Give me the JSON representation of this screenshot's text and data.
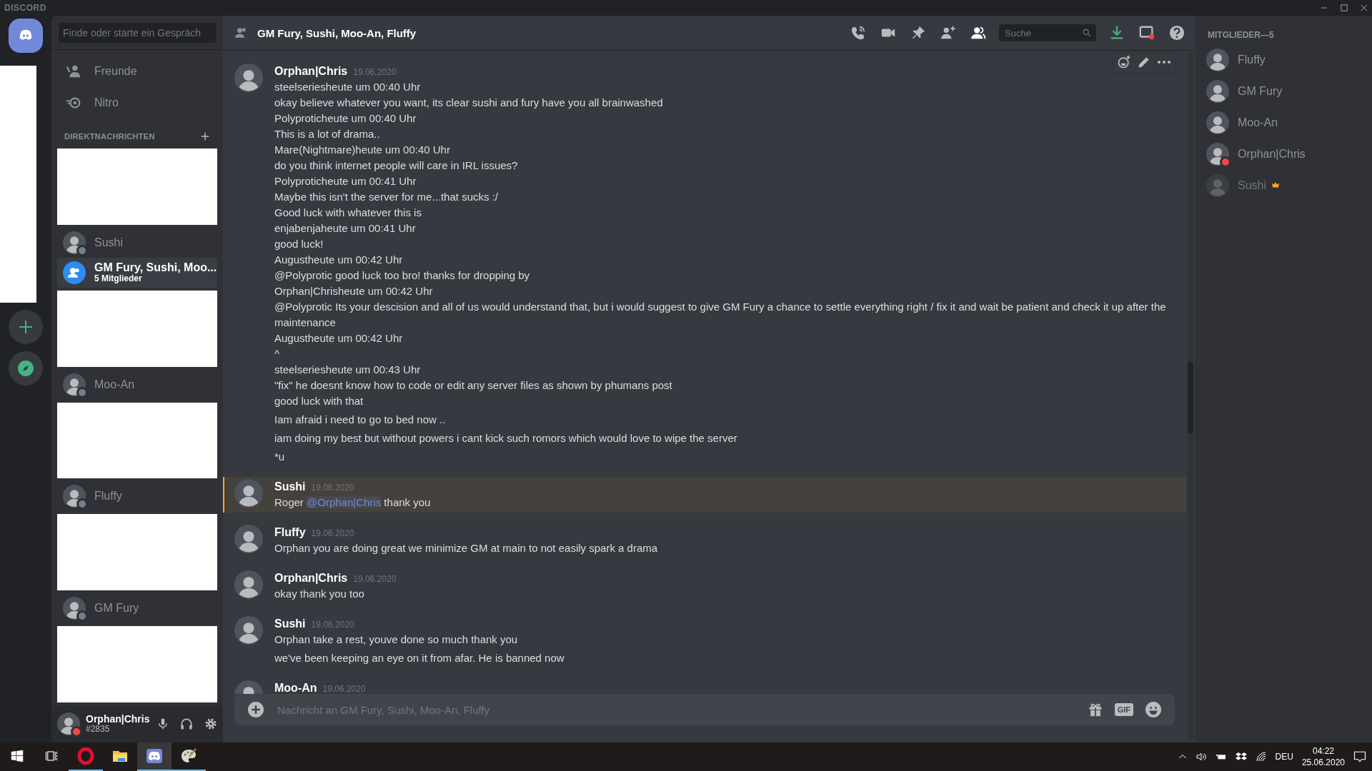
{
  "app_title": "DISCORD",
  "servers": [
    {
      "kind": "home"
    },
    {
      "kind": "redacted"
    },
    {
      "kind": "add"
    },
    {
      "kind": "explore"
    }
  ],
  "sidebar": {
    "search_placeholder": "Finde oder starte ein Gespräch",
    "nav": [
      {
        "kind": "friends",
        "label": "Freunde"
      },
      {
        "kind": "nitro",
        "label": "Nitro"
      }
    ],
    "section_title": "DIREKTNACHRICHTEN",
    "dms": [
      {
        "kind": "redacted"
      },
      {
        "kind": "user",
        "name": "Sushi",
        "offline": true,
        "selected": false
      },
      {
        "kind": "group",
        "name": "GM Fury, Sushi, Moo...",
        "subtitle": "5 Mitglieder",
        "selected": true
      },
      {
        "kind": "redacted"
      },
      {
        "kind": "user",
        "name": "Moo-An",
        "offline": true,
        "selected": false
      },
      {
        "kind": "redacted"
      },
      {
        "kind": "user",
        "name": "Fluffy",
        "offline": true,
        "selected": false
      },
      {
        "kind": "redacted"
      },
      {
        "kind": "user",
        "name": "GM Fury",
        "offline": true,
        "selected": false
      },
      {
        "kind": "redacted"
      }
    ]
  },
  "user_panel": {
    "name": "Orphan|Chris",
    "tag": "#2835",
    "do_not_disturb": true
  },
  "header": {
    "title": "GM Fury, Sushi, Moo-An, Fluffy",
    "search_placeholder": "Suche"
  },
  "messages": [
    {
      "author": "Orphan|Chris",
      "timestamp": "19.06.2020",
      "hovered": true,
      "mentioned": false,
      "posts": [
        {
          "lines": [
            "steelseriesheute um 00:40 Uhr",
            "okay believe whatever you want, its clear sushi and fury have you all brainwashed",
            "Polyproticheute um 00:40 Uhr",
            "This is a lot of drama..",
            "Mare(Nightmare)heute um 00:40 Uhr",
            "do you think internet people will care in IRL issues?",
            "Polyproticheute um 00:41 Uhr",
            "Maybe this isn't the server for me...that sucks :/",
            "Good luck with whatever this is",
            "enjabenjaheute um 00:41 Uhr",
            "good luck!",
            "Augustheute um 00:42 Uhr",
            "@Polyprotic good luck too bro! thanks for dropping by",
            "Orphan|Chrisheute um 00:42 Uhr",
            "@Polyprotic Its your descision and all of us would understand that, but i would suggest to give GM Fury a chance to settle everything right / fix it and wait be patient and check it up after the maintenance",
            "Augustheute um 00:42 Uhr",
            "^",
            "steelseriesheute um 00:43 Uhr",
            "\"fix\" he doesnt know how to code or edit any server files as shown by phumans post",
            "good luck with that"
          ]
        },
        {
          "lines": [
            "Iam afraid i need to go to bed now .."
          ]
        },
        {
          "lines": [
            "iam doing my best but without powers i cant kick such romors which would love to wipe the server"
          ]
        },
        {
          "lines": [
            "*u"
          ]
        }
      ]
    },
    {
      "author": "Sushi",
      "timestamp": "19.06.2020",
      "hovered": false,
      "mentioned": true,
      "posts": [
        {
          "lines": [
            {
              "before": "Roger ",
              "mention": "@Orphan|Chris",
              "after": " thank you"
            }
          ]
        }
      ]
    },
    {
      "author": "Fluffy",
      "timestamp": "19.06.2020",
      "hovered": false,
      "mentioned": false,
      "posts": [
        {
          "lines": [
            "Orphan you are doing great we minimize GM at main to not easily spark a drama"
          ]
        }
      ]
    },
    {
      "author": "Orphan|Chris",
      "timestamp": "19.06.2020",
      "hovered": false,
      "mentioned": false,
      "posts": [
        {
          "lines": [
            "okay thank you too"
          ]
        }
      ]
    },
    {
      "author": "Sushi",
      "timestamp": "19.06.2020",
      "hovered": false,
      "mentioned": false,
      "posts": [
        {
          "lines": [
            "Orphan take a rest, youve done so much thank you"
          ]
        },
        {
          "lines": [
            "we've been keeping an eye on it from afar.  He is banned now"
          ]
        }
      ]
    },
    {
      "author": "Moo-An",
      "timestamp": "19.06.2020",
      "hovered": false,
      "mentioned": false
    }
  ],
  "composer": {
    "placeholder": "Nachricht an GM Fury, Sushi, Moo-An, Fluffy",
    "gif_label": "GIF"
  },
  "members": {
    "title": "MITGLIEDER—5",
    "items": [
      {
        "name": "Fluffy",
        "do_not_disturb": false,
        "offline": false,
        "owner": false
      },
      {
        "name": "GM Fury",
        "do_not_disturb": false,
        "offline": false,
        "owner": false
      },
      {
        "name": "Moo-An",
        "do_not_disturb": false,
        "offline": false,
        "owner": false
      },
      {
        "name": "Orphan|Chris",
        "do_not_disturb": true,
        "offline": false,
        "owner": false
      },
      {
        "name": "Sushi",
        "do_not_disturb": false,
        "offline": true,
        "owner": true
      }
    ]
  },
  "taskbar": {
    "apps": [
      {
        "kind": "opera",
        "running": true,
        "active": false
      },
      {
        "kind": "explorer",
        "running": false,
        "active": false
      },
      {
        "kind": "discord",
        "running": true,
        "active": true
      },
      {
        "kind": "paint",
        "running": true,
        "active": false
      }
    ],
    "language": "DEU",
    "time": "04:22",
    "date": "25.06.2020"
  }
}
